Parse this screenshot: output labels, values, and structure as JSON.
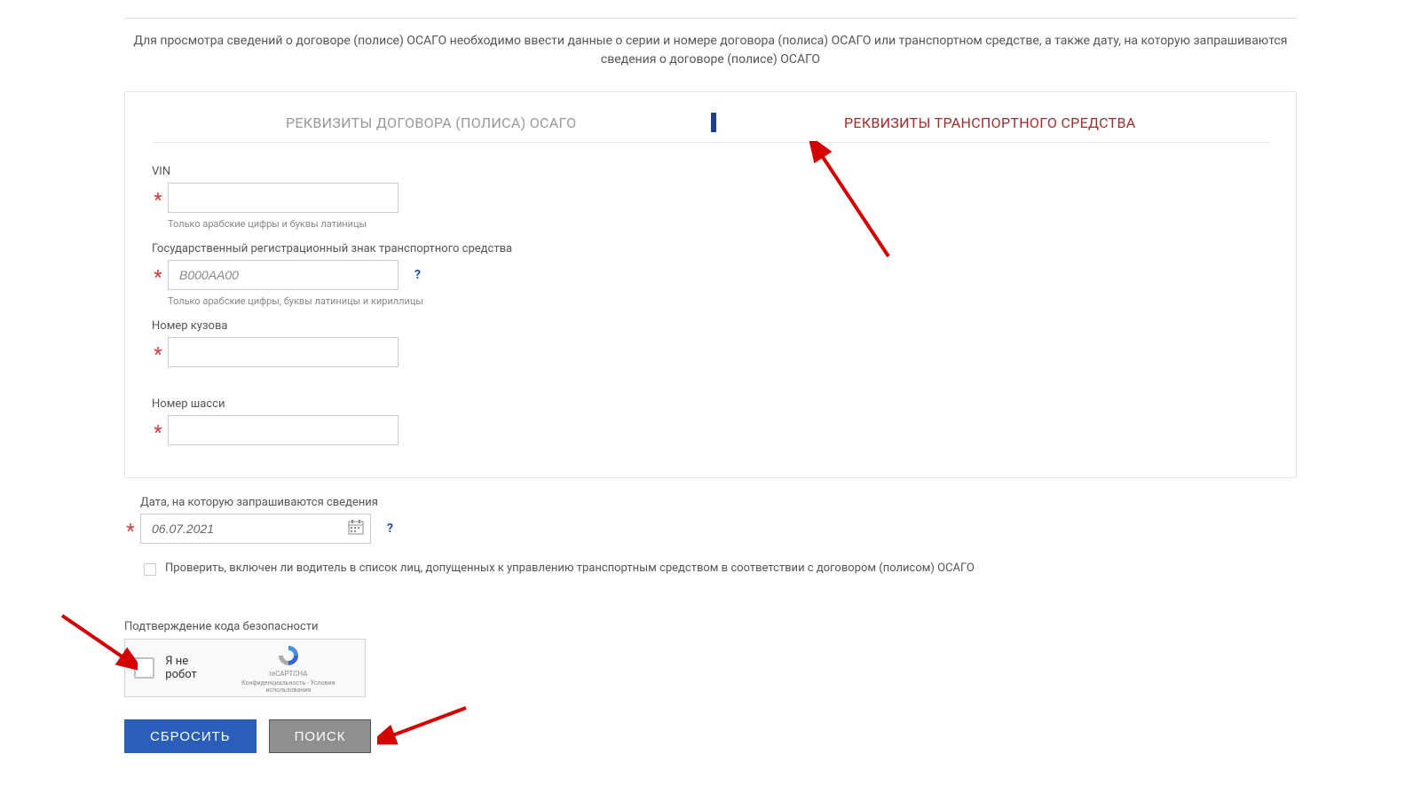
{
  "instruction": "Для просмотра сведений о договоре (полисе) ОСАГО необходимо ввести данные о серии и номере договора (полиса) ОСАГО или транспортном средстве, а также дату, на которую запрашиваются сведения о договоре (полисе) ОСАГО",
  "tabs": {
    "policy": "РЕКВИЗИТЫ ДОГОВОРА (ПОЛИСА) ОСАГО",
    "vehicle": "РЕКВИЗИТЫ ТРАНСПОРТНОГО СРЕДСТВА"
  },
  "fields": {
    "vin": {
      "label": "VIN",
      "hint": "Только арабские цифры и буквы латиницы",
      "value": ""
    },
    "reg": {
      "label": "Государственный регистрационный знак транспортного средства",
      "placeholder": "В000АА00",
      "hint": "Только арабские цифры, буквы латиницы и кириллицы",
      "value": ""
    },
    "body": {
      "label": "Номер кузова",
      "value": ""
    },
    "chassis": {
      "label": "Номер шасси",
      "value": ""
    },
    "date": {
      "label": "Дата, на которую запрашиваются сведения",
      "value": "06.07.2021"
    }
  },
  "check_driver": "Проверить, включен ли водитель в список лиц, допущенных к управлению транспортным средством в соответствии с договором (полисом) ОСАГО",
  "captcha": {
    "label": "Подтверждение кода безопасности",
    "text": "Я не робот",
    "brand": "reCAPTCHA",
    "links": "Конфиденциальность - Условия использования"
  },
  "buttons": {
    "reset": "СБРОСИТЬ",
    "search": "ПОИСК"
  },
  "asterisk": "*",
  "help": "?"
}
